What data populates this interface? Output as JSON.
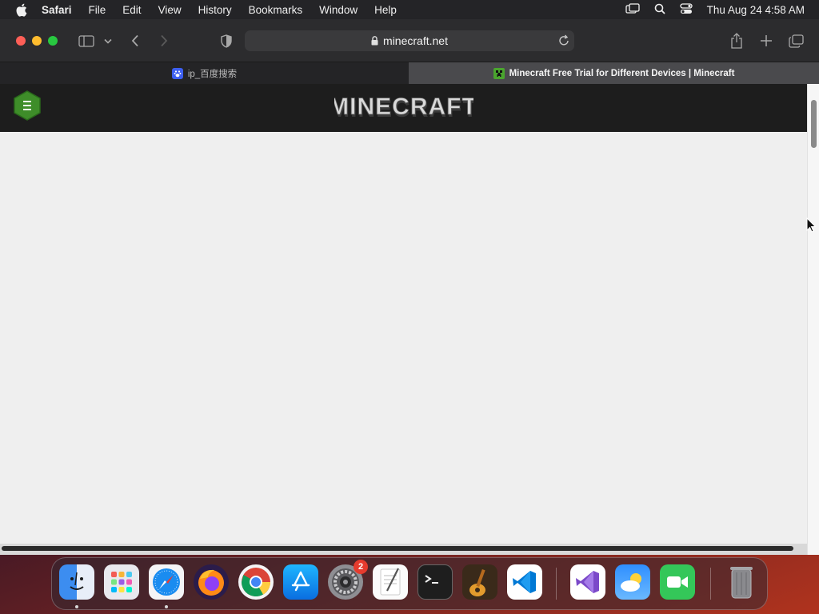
{
  "menubar": {
    "apple_icon": "apple-icon",
    "app_name": "Safari",
    "items": [
      "File",
      "Edit",
      "View",
      "History",
      "Bookmarks",
      "Window",
      "Help"
    ],
    "clock": "Thu Aug 24  4:58 AM"
  },
  "toolbar": {
    "url": "minecraft.net"
  },
  "tabs": [
    {
      "title": "ip_百度搜索",
      "favicon": "baidu-paw-icon",
      "active": false
    },
    {
      "title": "Minecraft Free Trial for Different Devices | Minecraft",
      "favicon": "creeper-icon",
      "active": true
    }
  ],
  "site": {
    "logo_text": "MINECRAFT"
  },
  "dock": {
    "apps": [
      "Finder",
      "Launchpad",
      "Safari",
      "Firefox",
      "Chrome",
      "App Store",
      "System Settings",
      "TextEdit",
      "Terminal",
      "GarageBand",
      "Visual Studio Code",
      "Visual Studio",
      "Weather",
      "FaceTime",
      "Trash"
    ],
    "settings_badge": "2"
  },
  "colors": {
    "page_background": "#efefef",
    "site_header": "#1d1d1d",
    "hamburger_green": "#3e8d29"
  }
}
